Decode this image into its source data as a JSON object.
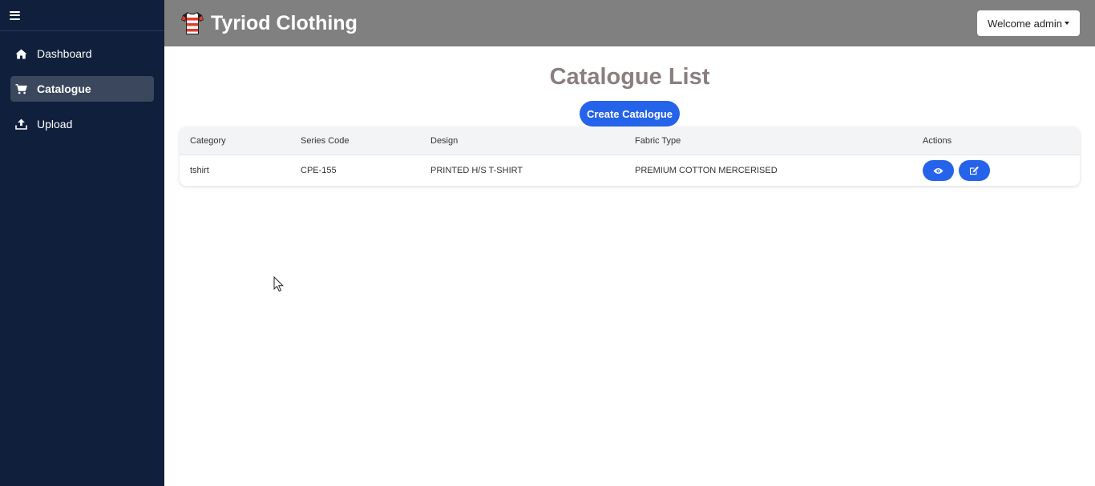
{
  "sidebar": {
    "items": [
      {
        "label": "Dashboard",
        "icon": "home-icon"
      },
      {
        "label": "Catalogue",
        "icon": "cart-icon",
        "active": true
      },
      {
        "label": "Upload",
        "icon": "upload-icon"
      }
    ]
  },
  "header": {
    "brand": "Tyriod Clothing",
    "welcome": "Welcome admin"
  },
  "main": {
    "title": "Catalogue List",
    "create_label": "Create Catalogue",
    "table": {
      "columns": [
        "Category",
        "Series Code",
        "Design",
        "Fabric Type",
        "Actions"
      ],
      "rows": [
        {
          "category": "tshirt",
          "series_code": "CPE-155",
          "design": "PRINTED H/S T-SHIRT",
          "fabric_type": "PREMIUM COTTON MERCERISED"
        }
      ]
    }
  },
  "colors": {
    "sidebar_bg": "#0f1f3c",
    "header_bg": "#808080",
    "accent": "#2563eb",
    "title": "#8a7f7f"
  }
}
